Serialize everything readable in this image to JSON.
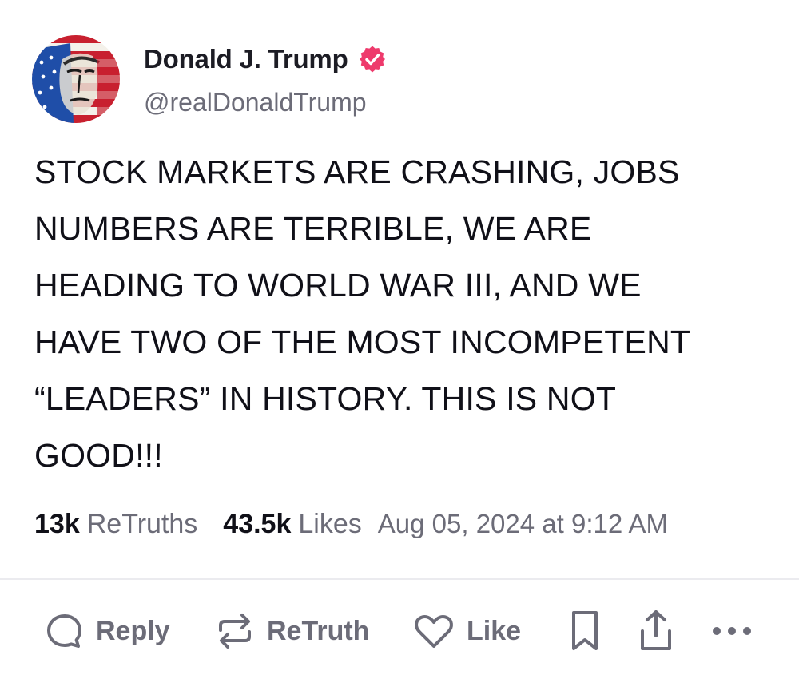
{
  "author": {
    "display_name": "Donald J. Trump",
    "handle": "@realDonaldTrump",
    "verified": true,
    "verified_color": "#ee3a6c"
  },
  "post": {
    "text": "STOCK MARKETS ARE CRASHING, JOBS\nNUMBERS ARE TERRIBLE, WE ARE\nHEADING TO WORLD WAR III, AND WE\nHAVE TWO OF THE MOST INCOMPETENT\n“LEADERS” IN HISTORY. THIS IS NOT\nGOOD!!!"
  },
  "stats": {
    "retruths_count": "13k",
    "retruths_label": "ReTruths",
    "likes_count": "43.5k",
    "likes_label": "Likes",
    "timestamp": "Aug 05, 2024 at 9:12 AM"
  },
  "actions": {
    "reply_label": "Reply",
    "retruth_label": "ReTruth",
    "like_label": "Like",
    "icons": [
      "reply-icon",
      "retruth-icon",
      "like-icon",
      "bookmark-icon",
      "share-icon",
      "more-icon"
    ]
  },
  "colors": {
    "text": "#101018",
    "muted": "#6c6c78",
    "divider": "#ebebef"
  }
}
